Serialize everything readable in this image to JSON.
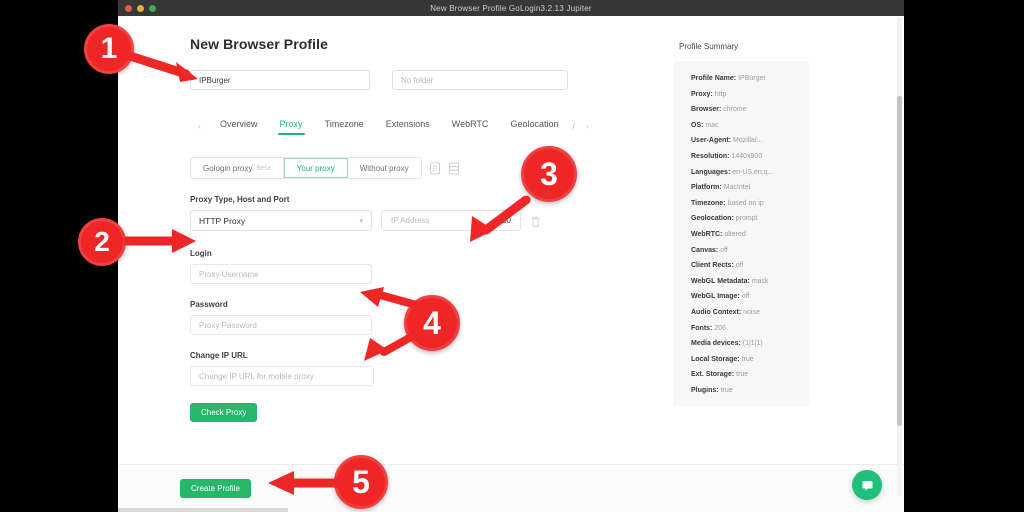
{
  "window": {
    "title": "New Browser Profile GoLogin3.2.13 Jupiter",
    "traffic_lights": [
      "close",
      "minimize",
      "maximize"
    ]
  },
  "page": {
    "title": "New Browser Profile"
  },
  "header_fields": {
    "profile_name_value": "IPBurger",
    "folder_placeholder": "No folder"
  },
  "tabs": {
    "prev_arrow": "‹",
    "next_arrow": "›",
    "overflow": "/",
    "items": [
      {
        "label": "Overview",
        "active": false
      },
      {
        "label": "Proxy",
        "active": true
      },
      {
        "label": "Timezone",
        "active": false
      },
      {
        "label": "Extensions",
        "active": false
      },
      {
        "label": "WebRTC",
        "active": false
      },
      {
        "label": "Geolocation",
        "active": false
      }
    ]
  },
  "proxy_mode": {
    "options": [
      {
        "label": "Gologin proxy",
        "badge": "Beta",
        "active": false
      },
      {
        "label": "Your proxy",
        "badge": "",
        "active": true
      },
      {
        "label": "Without proxy",
        "badge": "",
        "active": false
      }
    ],
    "icons": [
      "paste-document-icon",
      "proxy-list-icon"
    ]
  },
  "proxy_form": {
    "type_label": "Proxy Type, Host and Port",
    "type_value": "HTTP Proxy",
    "host_placeholder": "IP Address",
    "port_value": "80",
    "delete_icon": "trash-icon",
    "login_label": "Login",
    "login_placeholder": "Proxy Username",
    "password_label": "Password",
    "password_placeholder": "Proxy Password",
    "change_ip_label": "Change IP URL",
    "change_ip_placeholder": "Change IP URL for mobile proxy",
    "check_proxy_label": "Check Proxy"
  },
  "footer": {
    "create_profile_label": "Create Profile"
  },
  "summary": {
    "title": "Profile Summary",
    "items": [
      {
        "key": "Profile Name:",
        "value": "IPBurger"
      },
      {
        "key": "Proxy:",
        "value": "http"
      },
      {
        "key": "Browser:",
        "value": "chrome"
      },
      {
        "key": "OS:",
        "value": "mac"
      },
      {
        "key": "User-Agent:",
        "value": "Mozilla/..."
      },
      {
        "key": "Resolution:",
        "value": "1440x900"
      },
      {
        "key": "Languages:",
        "value": "en-US,en;q..."
      },
      {
        "key": "Platform:",
        "value": "MacIntel"
      },
      {
        "key": "Timezone:",
        "value": "based on ip"
      },
      {
        "key": "Geolocation:",
        "value": "prompt"
      },
      {
        "key": "WebRTC:",
        "value": "altered"
      },
      {
        "key": "Canvas:",
        "value": "off"
      },
      {
        "key": "Client Rects:",
        "value": "off"
      },
      {
        "key": "WebGL Metadata:",
        "value": "mask"
      },
      {
        "key": "WebGL Image:",
        "value": "off"
      },
      {
        "key": "Audio Context:",
        "value": "noise"
      },
      {
        "key": "Fonts:",
        "value": "206"
      },
      {
        "key": "Media devices:",
        "value": "(1|1|1)"
      },
      {
        "key": "Local Storage:",
        "value": "true"
      },
      {
        "key": "Ext. Storage:",
        "value": "true"
      },
      {
        "key": "Plugins:",
        "value": "true"
      }
    ]
  },
  "support": {
    "chat_icon": "chat-bubble-icon"
  },
  "annotations": {
    "color": "#ef2626",
    "steps": [
      {
        "number": "1",
        "target": "profile-name-input"
      },
      {
        "number": "2",
        "target": "proxy-type-select"
      },
      {
        "number": "3",
        "target": "proxy-host-port-input"
      },
      {
        "number": "4",
        "target": "login-password-fields"
      },
      {
        "number": "5",
        "target": "create-profile-button"
      }
    ]
  }
}
